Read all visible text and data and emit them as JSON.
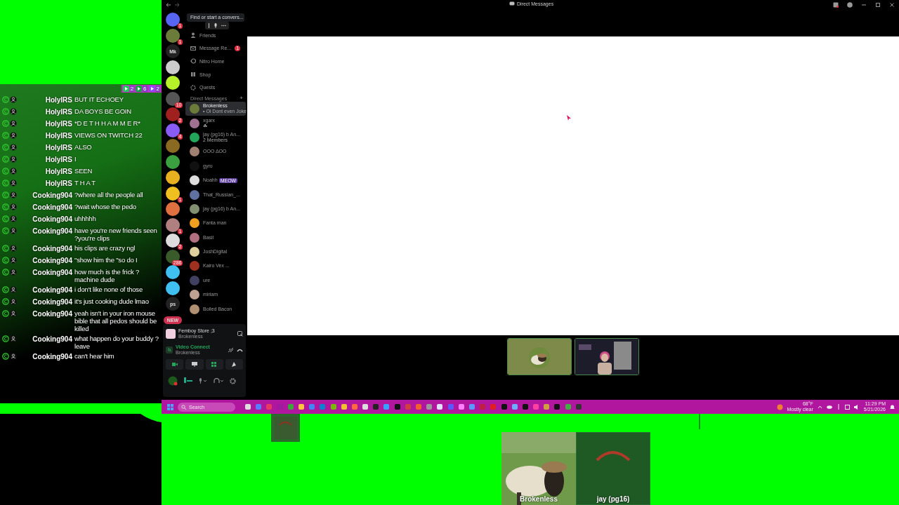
{
  "chat": {
    "counters": [
      {
        "count": "2",
        "color": "#22c55e"
      },
      {
        "count": "6",
        "color": "#16a34a"
      },
      {
        "count": "2",
        "color": "#9146ff"
      }
    ],
    "messages": [
      {
        "user": "HolyIRS",
        "text": "BUT IT ECHOEY"
      },
      {
        "user": "HolyIRS",
        "text": "DA BOYS BE GOIN"
      },
      {
        "user": "HolyIRS",
        "text": "*D E T H H A M M E R*"
      },
      {
        "user": "HolyIRS",
        "text": "VIEWS ON TWITCH 22"
      },
      {
        "user": "HolyIRS",
        "text": "ALSO"
      },
      {
        "user": "HolyIRS",
        "text": "I"
      },
      {
        "user": "HolyIRS",
        "text": "SEEN"
      },
      {
        "user": "HolyIRS",
        "text": "T H A T"
      },
      {
        "user": "Cooking904",
        "text": "?where all the people all"
      },
      {
        "user": "Cooking904",
        "text": "?wait whose the pedo"
      },
      {
        "user": "Cooking904",
        "text": "uhhhhh"
      },
      {
        "user": "Cooking904",
        "text": "have you're new friends seen ?you're clips"
      },
      {
        "user": "Cooking904",
        "text": "his clips are crazy ngl"
      },
      {
        "user": "Cooking904",
        "text": "\"show him the \"so do I"
      },
      {
        "user": "Cooking904",
        "text": "how much is the frick ?machine dude"
      },
      {
        "user": "Cooking904",
        "text": "i don't like none of those"
      },
      {
        "user": "Cooking904",
        "text": "it's just cooking dude lmao"
      },
      {
        "user": "Cooking904",
        "text": "yeah isn't in your iron mouse bible that all pedos should be killed"
      },
      {
        "user": "Cooking904",
        "text": "what happen do your buddy ?leave"
      },
      {
        "user": "Cooking904",
        "text": "can't hear him"
      }
    ]
  },
  "discord": {
    "window": {
      "title": "Direct Messages"
    },
    "servers": [
      {
        "color": "#5865f2",
        "badge": "1"
      },
      {
        "color": "#6b7b3a",
        "badge": "1"
      },
      {
        "color": "#222222",
        "label": "Mk"
      },
      {
        "color": "#cccccc"
      },
      {
        "color": "#b6f22a"
      },
      {
        "color": "#555555",
        "badge": "10"
      },
      {
        "color": "#a02020",
        "badge": "2"
      },
      {
        "color": "#8a5cf6",
        "badge": "4"
      },
      {
        "color": "#8a6a20"
      },
      {
        "color": "#3aa040"
      },
      {
        "color": "#e8b020"
      },
      {
        "color": "#f0c020",
        "badge": "1"
      },
      {
        "color": "#e07040"
      },
      {
        "color": "#b08080",
        "badge": "1"
      },
      {
        "color": "#dddddd",
        "badge": "2"
      },
      {
        "color": "#3a5a2a",
        "badge": "286"
      },
      {
        "color": "#40c0f0"
      },
      {
        "color": "#40c0f0"
      },
      {
        "color": "#222222",
        "label": "ps"
      },
      {
        "color": "#d03050",
        "label": "NEW"
      }
    ],
    "search": {
      "placeholder": "Find or start a convers..."
    },
    "nav": [
      {
        "label": "Friends"
      },
      {
        "label": "Message Re...",
        "badge": "1"
      },
      {
        "label": "Nitro Home"
      },
      {
        "label": "Shop"
      },
      {
        "label": "Quests"
      }
    ],
    "dm_header": "Direct Messages",
    "add": "+",
    "dms": [
      {
        "name": "Brokenless",
        "sub": "• Oi Dont even Joke",
        "selected": true,
        "color": "#6b7b3a"
      },
      {
        "name": "xgarx",
        "sub": "☘",
        "selected": false,
        "color": "#a07090"
      },
      {
        "name": "jay (pg16) b An...",
        "sub": "2 Members",
        "selected": false,
        "color": "#23a55a"
      },
      {
        "name": "ΟΟΟ ΔΟΟ",
        "selected": false,
        "color": "#a08070"
      },
      {
        "name": "gyro",
        "selected": false,
        "color": "#111111"
      },
      {
        "name": "Noahh",
        "tag": "MEOW",
        "selected": false,
        "color": "#dddddd"
      },
      {
        "name": "That_Russian_...",
        "selected": false,
        "color": "#6070a0"
      },
      {
        "name": "jay (pg16) b An...",
        "selected": false,
        "color": "#809070"
      },
      {
        "name": "Fanta man",
        "selected": false,
        "color": "#f0a020"
      },
      {
        "name": "Basil",
        "selected": false,
        "color": "#b07080"
      },
      {
        "name": "JoshDigital",
        "selected": false,
        "color": "#e0d0a0"
      },
      {
        "name": "Kairo Vex ...",
        "selected": false,
        "color": "#a03020"
      },
      {
        "name": "ure",
        "selected": false,
        "color": "#404060"
      },
      {
        "name": "miriam",
        "selected": false,
        "color": "#c0a090"
      },
      {
        "name": "Boiled Bacon",
        "selected": false,
        "color": "#b09070"
      }
    ],
    "panel": {
      "activity": {
        "title": "Femboy Store ;3",
        "sub": "Brokenless"
      },
      "voice": {
        "status": "Video Connect",
        "sub": "Brokenless"
      }
    },
    "call_tiles": [
      {
        "kind": "avatar"
      },
      {
        "kind": "camera"
      }
    ]
  },
  "taskbar": {
    "search": {
      "placeholder": "Search"
    },
    "weather": {
      "temp": "68°F",
      "desc": "Mostly clear"
    },
    "time": "11:29 PM",
    "date": "5/21/2026"
  },
  "stream_tiles": [
    {
      "name": "Brokenless",
      "kind": "sheep"
    },
    {
      "name": "jay (pg16)",
      "kind": "pattern"
    }
  ]
}
